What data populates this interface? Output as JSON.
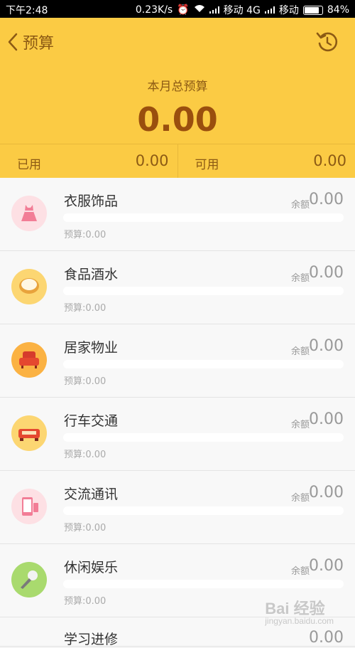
{
  "status_bar": {
    "time": "下午2:48",
    "speed": "0.23K/s",
    "carrier1": "移动 4G",
    "carrier2": "移动",
    "battery": "84%",
    "battery_level": 0.84
  },
  "header": {
    "title": "预算",
    "month_label": "本月总预算",
    "month_value": "0.00",
    "used_label": "已用",
    "used_value": "0.00",
    "available_label": "可用",
    "available_value": "0.00",
    "bg_color": "#fbcb44"
  },
  "categories": [
    {
      "name": "衣服饰品",
      "remain_label": "余额",
      "remain": "0.00",
      "budget": "预算:0.00",
      "icon": "dress-icon",
      "progress": 0
    },
    {
      "name": "食品酒水",
      "remain_label": "余额",
      "remain": "0.00",
      "budget": "预算:0.00",
      "icon": "food-bowl-icon",
      "progress": 0
    },
    {
      "name": "居家物业",
      "remain_label": "余额",
      "remain": "0.00",
      "budget": "预算:0.00",
      "icon": "armchair-icon",
      "progress": 0
    },
    {
      "name": "行车交通",
      "remain_label": "余额",
      "remain": "0.00",
      "budget": "预算:0.00",
      "icon": "car-icon",
      "progress": 0
    },
    {
      "name": "交流通讯",
      "remain_label": "余额",
      "remain": "0.00",
      "budget": "预算:0.00",
      "icon": "phone-icon",
      "progress": 0
    },
    {
      "name": "休闲娱乐",
      "remain_label": "余额",
      "remain": "0.00",
      "budget": "预算:0.00",
      "icon": "microphone-icon",
      "progress": 0
    },
    {
      "name": "学习进修",
      "remain": "0.00"
    }
  ],
  "watermark": {
    "text": "Bai 经验",
    "sub": "jingyan.baidu.com"
  }
}
